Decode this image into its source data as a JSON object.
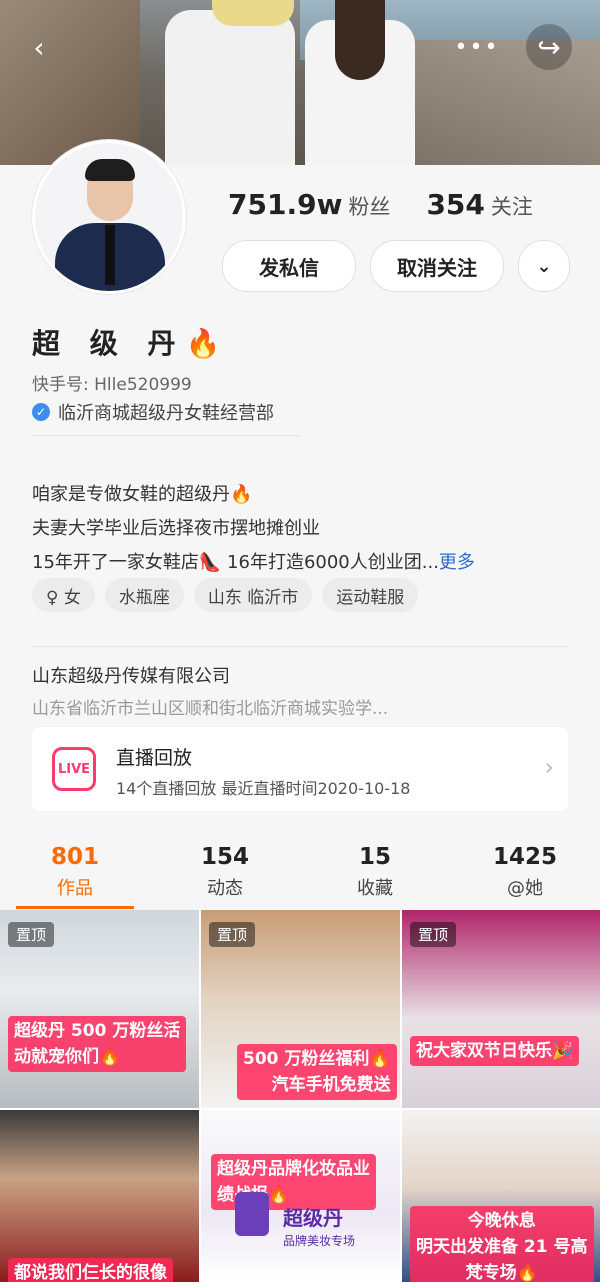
{
  "nav": {
    "back": "‹",
    "more": "•••",
    "share": "↪"
  },
  "profile": {
    "fans_count": "751.9w",
    "fans_label": "粉丝",
    "follow_count": "354",
    "follow_label": "关注",
    "message_button": "发私信",
    "unfollow_button": "取消关注",
    "dropdown": "⌄",
    "name": "超 级 丹",
    "name_emoji": "🔥",
    "kuaishou_id": "快手号: Hlle520999",
    "verified_text": "临沂商城超级丹女鞋经营部",
    "bio": [
      "咱家是专做女鞋的超级丹🔥",
      "夫妻大学毕业后选择夜市摆地摊创业",
      "15年开了一家女鞋店👠 16年打造6000人创业团..."
    ],
    "bio_more": "更多",
    "tags": [
      "♀ 女",
      "水瓶座",
      "山东 临沂市",
      "运动鞋服"
    ],
    "company": "山东超级丹传媒有限公司",
    "address": "山东省临沂市兰山区顺和街北临沂商城实验学..."
  },
  "live": {
    "icon_text": "LIVE",
    "title": "直播回放",
    "subtitle": "14个直播回放 最近直播时间2020-10-18",
    "chevron": "›"
  },
  "tabs": [
    {
      "count": "801",
      "label": "作品"
    },
    {
      "count": "154",
      "label": "动态"
    },
    {
      "count": "15",
      "label": "收藏"
    },
    {
      "count": "1425",
      "label": "@她"
    }
  ],
  "posts": [
    {
      "pin": "置顶",
      "caption": [
        "超级丹 500 万粉丝活",
        "动就宠你们🔥"
      ]
    },
    {
      "pin": "置顶",
      "caption": [
        "500 万粉丝福利🔥",
        "汽车手机免费送"
      ]
    },
    {
      "pin": "置顶",
      "caption": [
        "祝大家双节日快乐🎉"
      ]
    },
    {
      "caption": [
        "都说我们仨长的很像"
      ]
    },
    {
      "caption": [
        "超级丹品牌化妆品业",
        "绩战报🔥"
      ],
      "brand": "超级丹",
      "brand_sub": "品牌美妆专场"
    },
    {
      "caption": [
        "今晚休息",
        "明天出发准备 21 号高",
        "梵专场🔥"
      ]
    }
  ],
  "colors": {
    "accent": "#ff6a00",
    "live": "#ff3b6b",
    "link": "#2f6bcf",
    "verify": "#3d8ef0"
  }
}
